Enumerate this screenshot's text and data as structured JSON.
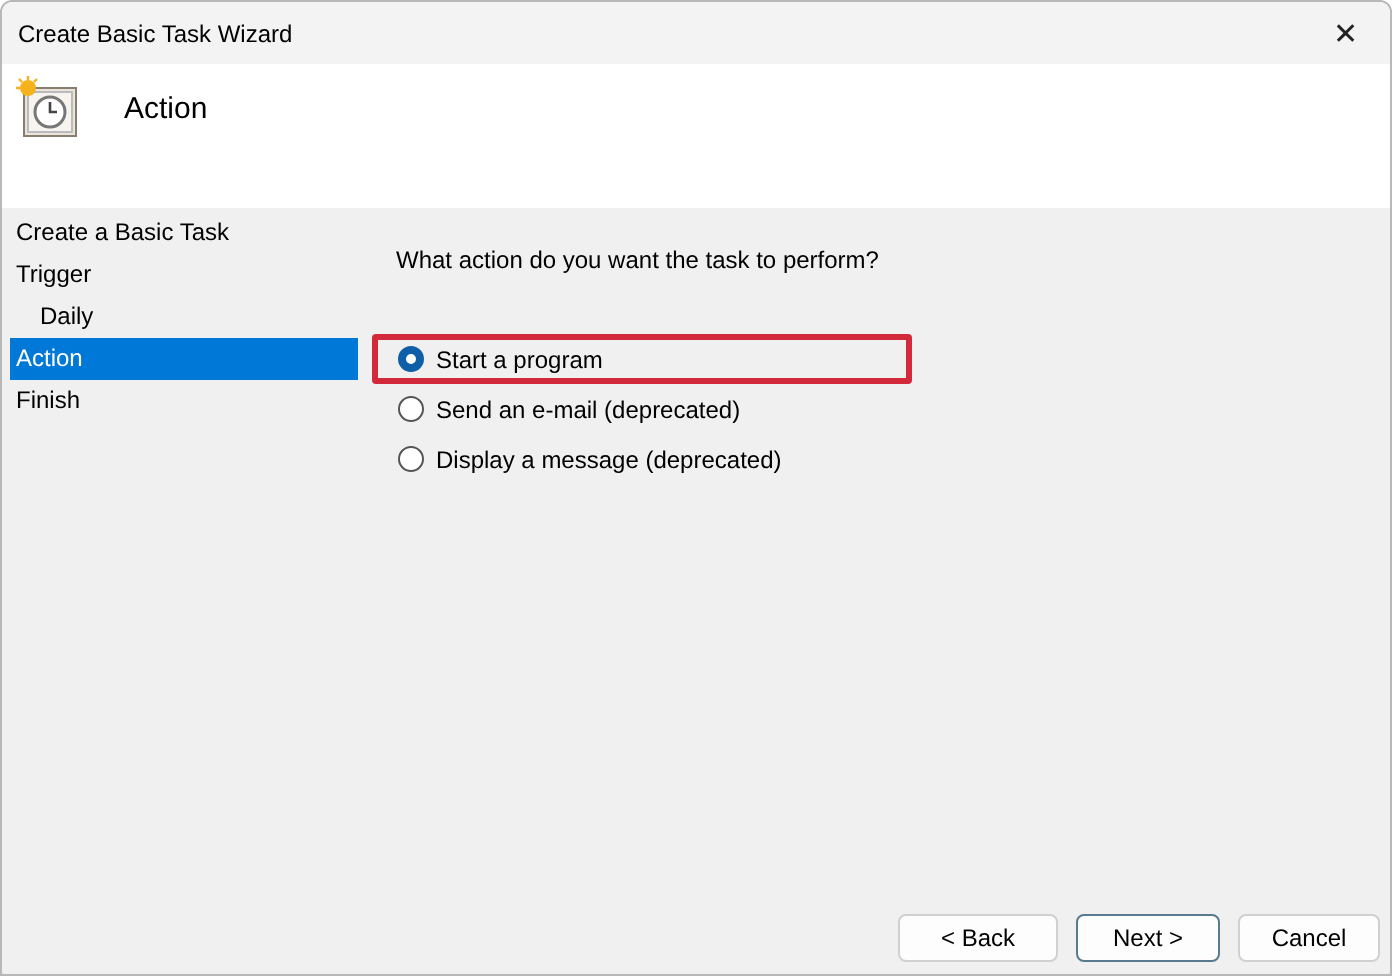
{
  "window": {
    "title": "Create Basic Task Wizard",
    "close": "✕"
  },
  "header": {
    "title": "Action"
  },
  "sidebar": {
    "items": [
      {
        "label": "Create a Basic Task",
        "selected": false
      },
      {
        "label": "Trigger",
        "selected": false,
        "children": [
          {
            "label": "Daily",
            "selected": false
          }
        ]
      },
      {
        "label": "Action",
        "selected": true
      },
      {
        "label": "Finish",
        "selected": false
      }
    ]
  },
  "question": "What action do you want the task to perform?",
  "options": [
    {
      "label": "Start a program",
      "selected": true,
      "highlighted": true
    },
    {
      "label": "Send an e-mail (deprecated)",
      "selected": false,
      "highlighted": false
    },
    {
      "label": "Display a message (deprecated)",
      "selected": false,
      "highlighted": false
    }
  ],
  "buttons": [
    {
      "label": "< Back",
      "default": false
    },
    {
      "label": "Next >",
      "default": true
    },
    {
      "label": "Cancel",
      "default": false
    }
  ]
}
